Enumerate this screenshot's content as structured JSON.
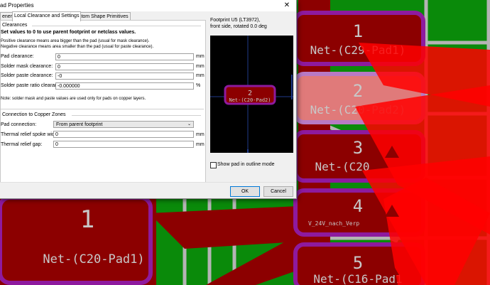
{
  "dialog": {
    "title": "ad Properties",
    "close_glyph": "✕",
    "tabs": [
      "eneral",
      "Local Clearance and Settings",
      "Custom Shape Primitives"
    ],
    "clearances": {
      "section_title": "Clearances",
      "heading": "Set values to 0 to use parent footprint or netclass values.",
      "note1": "Positive clearance means area bigger than the pad (usual for mask clearance).",
      "note2": "Negative clearance means area smaller than the pad (usual for paste clearance).",
      "rows": [
        {
          "label": "Pad clearance:",
          "value": "0",
          "unit": "mm"
        },
        {
          "label": "Solder mask clearance:",
          "value": "0",
          "unit": "mm"
        },
        {
          "label": "Solder paste clearance:",
          "value": "-0",
          "unit": "mm"
        },
        {
          "label": "Solder paste ratio clearance:",
          "value": "-0.000000",
          "unit": "%"
        }
      ],
      "footnote": "Note: solder mask and paste values are used only for pads on copper layers."
    },
    "zones": {
      "section_title": "Connection to Copper Zones",
      "pad_connection_label": "Pad connection:",
      "pad_connection_value": "From parent footprint",
      "rows": [
        {
          "label": "Thermal relief spoke width:",
          "value": "0",
          "unit": "mm"
        },
        {
          "label": "Thermal relief gap:",
          "value": "0",
          "unit": "mm"
        }
      ]
    },
    "footprint_info": {
      "line1": "Footprint U5 (LT3972),",
      "line2": "front side, rotated 0.0 deg"
    },
    "preview": {
      "pad_number": "2",
      "pad_net": "Net-(C20-Pad2)"
    },
    "show_outline_label": "Show pad in outline mode",
    "ok_label": "OK",
    "cancel_label": "Cancel"
  },
  "pcb": {
    "pads": [
      {
        "number": "1",
        "net": "Net-(C29-Pad1)"
      },
      {
        "number": "2",
        "net": "Net-(C20-Pad2)"
      },
      {
        "number": "3",
        "net": "Net-(C20"
      },
      {
        "number": "4",
        "net": "V_24V_nach_Verp"
      },
      {
        "number": "5",
        "net": "Net-(C16-Pad1"
      }
    ],
    "big_pad": {
      "number": "1",
      "net": "Net-(C20-Pad1)"
    }
  },
  "colors": {
    "board": "#0a8a0a",
    "copper": "#8c0000",
    "pad_ring": "#8e1a9e",
    "highlight": "#e07a7a",
    "ratsnest": "#ff0000",
    "silk": "#c8c8c8"
  }
}
